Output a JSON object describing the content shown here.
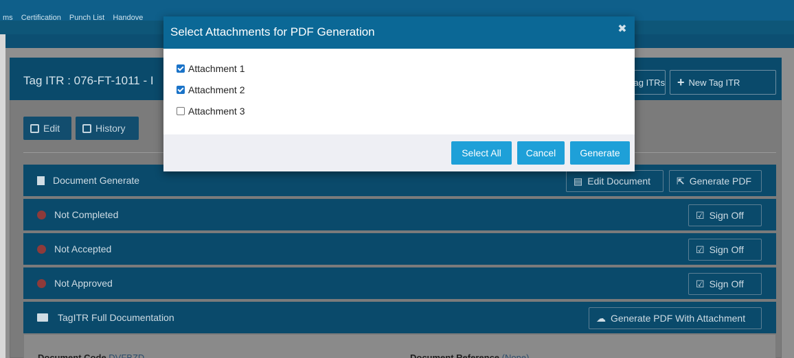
{
  "nav": {
    "items": [
      "ms",
      "Certification",
      "Punch List",
      "Handove"
    ]
  },
  "panel": {
    "title": "Tag ITR : 076-FT-1011 - I",
    "tag_itrs_label": "Tag ITRs",
    "new_tag_itr_label": "New Tag ITR",
    "edit_label": "Edit",
    "history_label": "History"
  },
  "rows": {
    "document_generate": {
      "label": "Document Generate",
      "edit_document": "Edit Document",
      "generate_pdf": "Generate PDF"
    },
    "not_completed": {
      "label": "Not Completed",
      "sign_off": "Sign Off"
    },
    "not_accepted": {
      "label": "Not Accepted",
      "sign_off": "Sign Off"
    },
    "not_approved": {
      "label": "Not Approved",
      "sign_off": "Sign Off"
    },
    "full_documentation": {
      "label": "TagITR Full Documentation",
      "generate_with_attachment": "Generate PDF With Attachment"
    }
  },
  "info": {
    "document_code_key": "Document Code",
    "document_code_value": "DVFBZD",
    "document_reference_key": "Document Reference",
    "document_reference_value": "(None)"
  },
  "modal": {
    "title": "Select Attachments for PDF Generation",
    "close_glyph": "✖",
    "attachments": [
      {
        "label": "Attachment 1",
        "checked": true
      },
      {
        "label": "Attachment 2",
        "checked": true
      },
      {
        "label": "Attachment 3",
        "checked": false
      }
    ],
    "select_all_label": "Select All",
    "cancel_label": "Cancel",
    "generate_label": "Generate"
  },
  "colors": {
    "modal_header": "#0b6896",
    "primary_button": "#1ea0d8",
    "checkbox_checked": "#1a73c8"
  }
}
